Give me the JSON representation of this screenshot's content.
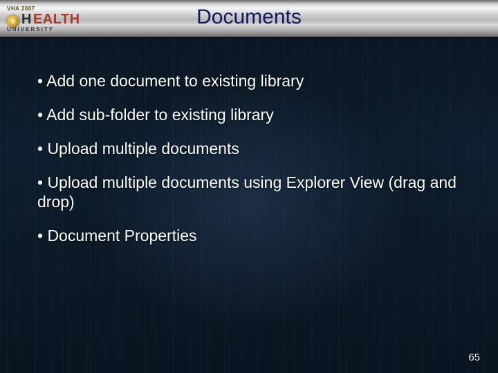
{
  "header": {
    "title": "Documents",
    "logo": {
      "tagline": "VHA 2007",
      "e_glyph": "e",
      "first_letter": "H",
      "rest": "EALTH",
      "subtitle": "UNIVERSITY"
    }
  },
  "bullets": [
    "Add one document to existing library",
    "Add sub-folder to existing library",
    "Upload multiple documents",
    "Upload multiple documents using Explorer View (drag and drop)",
    "Document Properties"
  ],
  "footer": {
    "page_number": "65"
  }
}
